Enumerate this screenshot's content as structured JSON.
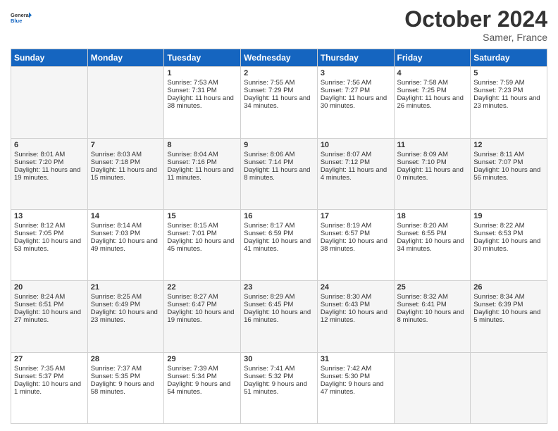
{
  "logo": {
    "general": "General",
    "blue": "Blue"
  },
  "header": {
    "month": "October 2024",
    "location": "Samer, France"
  },
  "weekdays": [
    "Sunday",
    "Monday",
    "Tuesday",
    "Wednesday",
    "Thursday",
    "Friday",
    "Saturday"
  ],
  "weeks": [
    [
      {
        "day": "",
        "info": ""
      },
      {
        "day": "",
        "info": ""
      },
      {
        "day": "1",
        "sunrise": "Sunrise: 7:53 AM",
        "sunset": "Sunset: 7:31 PM",
        "daylight": "Daylight: 11 hours and 38 minutes."
      },
      {
        "day": "2",
        "sunrise": "Sunrise: 7:55 AM",
        "sunset": "Sunset: 7:29 PM",
        "daylight": "Daylight: 11 hours and 34 minutes."
      },
      {
        "day": "3",
        "sunrise": "Sunrise: 7:56 AM",
        "sunset": "Sunset: 7:27 PM",
        "daylight": "Daylight: 11 hours and 30 minutes."
      },
      {
        "day": "4",
        "sunrise": "Sunrise: 7:58 AM",
        "sunset": "Sunset: 7:25 PM",
        "daylight": "Daylight: 11 hours and 26 minutes."
      },
      {
        "day": "5",
        "sunrise": "Sunrise: 7:59 AM",
        "sunset": "Sunset: 7:23 PM",
        "daylight": "Daylight: 11 hours and 23 minutes."
      }
    ],
    [
      {
        "day": "6",
        "sunrise": "Sunrise: 8:01 AM",
        "sunset": "Sunset: 7:20 PM",
        "daylight": "Daylight: 11 hours and 19 minutes."
      },
      {
        "day": "7",
        "sunrise": "Sunrise: 8:03 AM",
        "sunset": "Sunset: 7:18 PM",
        "daylight": "Daylight: 11 hours and 15 minutes."
      },
      {
        "day": "8",
        "sunrise": "Sunrise: 8:04 AM",
        "sunset": "Sunset: 7:16 PM",
        "daylight": "Daylight: 11 hours and 11 minutes."
      },
      {
        "day": "9",
        "sunrise": "Sunrise: 8:06 AM",
        "sunset": "Sunset: 7:14 PM",
        "daylight": "Daylight: 11 hours and 8 minutes."
      },
      {
        "day": "10",
        "sunrise": "Sunrise: 8:07 AM",
        "sunset": "Sunset: 7:12 PM",
        "daylight": "Daylight: 11 hours and 4 minutes."
      },
      {
        "day": "11",
        "sunrise": "Sunrise: 8:09 AM",
        "sunset": "Sunset: 7:10 PM",
        "daylight": "Daylight: 11 hours and 0 minutes."
      },
      {
        "day": "12",
        "sunrise": "Sunrise: 8:11 AM",
        "sunset": "Sunset: 7:07 PM",
        "daylight": "Daylight: 10 hours and 56 minutes."
      }
    ],
    [
      {
        "day": "13",
        "sunrise": "Sunrise: 8:12 AM",
        "sunset": "Sunset: 7:05 PM",
        "daylight": "Daylight: 10 hours and 53 minutes."
      },
      {
        "day": "14",
        "sunrise": "Sunrise: 8:14 AM",
        "sunset": "Sunset: 7:03 PM",
        "daylight": "Daylight: 10 hours and 49 minutes."
      },
      {
        "day": "15",
        "sunrise": "Sunrise: 8:15 AM",
        "sunset": "Sunset: 7:01 PM",
        "daylight": "Daylight: 10 hours and 45 minutes."
      },
      {
        "day": "16",
        "sunrise": "Sunrise: 8:17 AM",
        "sunset": "Sunset: 6:59 PM",
        "daylight": "Daylight: 10 hours and 41 minutes."
      },
      {
        "day": "17",
        "sunrise": "Sunrise: 8:19 AM",
        "sunset": "Sunset: 6:57 PM",
        "daylight": "Daylight: 10 hours and 38 minutes."
      },
      {
        "day": "18",
        "sunrise": "Sunrise: 8:20 AM",
        "sunset": "Sunset: 6:55 PM",
        "daylight": "Daylight: 10 hours and 34 minutes."
      },
      {
        "day": "19",
        "sunrise": "Sunrise: 8:22 AM",
        "sunset": "Sunset: 6:53 PM",
        "daylight": "Daylight: 10 hours and 30 minutes."
      }
    ],
    [
      {
        "day": "20",
        "sunrise": "Sunrise: 8:24 AM",
        "sunset": "Sunset: 6:51 PM",
        "daylight": "Daylight: 10 hours and 27 minutes."
      },
      {
        "day": "21",
        "sunrise": "Sunrise: 8:25 AM",
        "sunset": "Sunset: 6:49 PM",
        "daylight": "Daylight: 10 hours and 23 minutes."
      },
      {
        "day": "22",
        "sunrise": "Sunrise: 8:27 AM",
        "sunset": "Sunset: 6:47 PM",
        "daylight": "Daylight: 10 hours and 19 minutes."
      },
      {
        "day": "23",
        "sunrise": "Sunrise: 8:29 AM",
        "sunset": "Sunset: 6:45 PM",
        "daylight": "Daylight: 10 hours and 16 minutes."
      },
      {
        "day": "24",
        "sunrise": "Sunrise: 8:30 AM",
        "sunset": "Sunset: 6:43 PM",
        "daylight": "Daylight: 10 hours and 12 minutes."
      },
      {
        "day": "25",
        "sunrise": "Sunrise: 8:32 AM",
        "sunset": "Sunset: 6:41 PM",
        "daylight": "Daylight: 10 hours and 8 minutes."
      },
      {
        "day": "26",
        "sunrise": "Sunrise: 8:34 AM",
        "sunset": "Sunset: 6:39 PM",
        "daylight": "Daylight: 10 hours and 5 minutes."
      }
    ],
    [
      {
        "day": "27",
        "sunrise": "Sunrise: 7:35 AM",
        "sunset": "Sunset: 5:37 PM",
        "daylight": "Daylight: 10 hours and 1 minute."
      },
      {
        "day": "28",
        "sunrise": "Sunrise: 7:37 AM",
        "sunset": "Sunset: 5:35 PM",
        "daylight": "Daylight: 9 hours and 58 minutes."
      },
      {
        "day": "29",
        "sunrise": "Sunrise: 7:39 AM",
        "sunset": "Sunset: 5:34 PM",
        "daylight": "Daylight: 9 hours and 54 minutes."
      },
      {
        "day": "30",
        "sunrise": "Sunrise: 7:41 AM",
        "sunset": "Sunset: 5:32 PM",
        "daylight": "Daylight: 9 hours and 51 minutes."
      },
      {
        "day": "31",
        "sunrise": "Sunrise: 7:42 AM",
        "sunset": "Sunset: 5:30 PM",
        "daylight": "Daylight: 9 hours and 47 minutes."
      },
      {
        "day": "",
        "info": ""
      },
      {
        "day": "",
        "info": ""
      }
    ]
  ]
}
